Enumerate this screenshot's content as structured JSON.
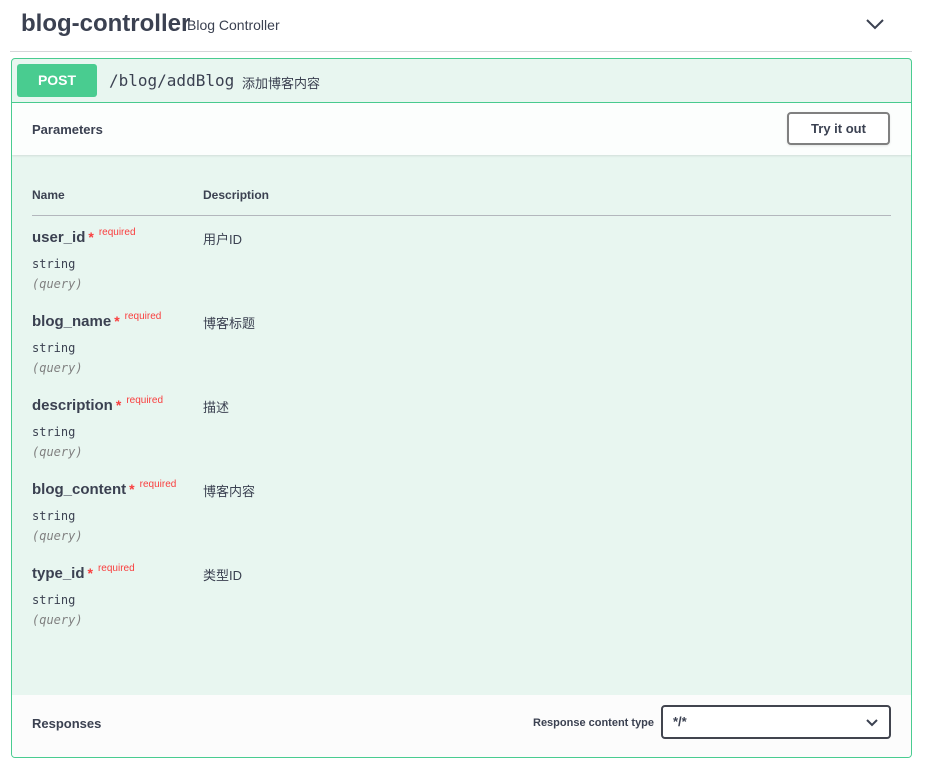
{
  "tag": {
    "name": "blog-controller",
    "description": "Blog Controller"
  },
  "operation": {
    "method": "POST",
    "path": "/blog/addBlog",
    "summary": "添加博客内容",
    "color": "#49cc90"
  },
  "parameters_section": {
    "title": "Parameters",
    "try_button": "Try it out",
    "col_name": "Name",
    "col_description": "Description",
    "params": [
      {
        "name": "user_id",
        "star": "*",
        "required": "required",
        "type": "string",
        "in": "(query)",
        "description": "用户ID"
      },
      {
        "name": "blog_name",
        "star": "*",
        "required": "required",
        "type": "string",
        "in": "(query)",
        "description": "博客标题"
      },
      {
        "name": "description",
        "star": "*",
        "required": "required",
        "type": "string",
        "in": "(query)",
        "description": "描述"
      },
      {
        "name": "blog_content",
        "star": "*",
        "required": "required",
        "type": "string",
        "in": "(query)",
        "description": "博客内容"
      },
      {
        "name": "type_id",
        "star": "*",
        "required": "required",
        "type": "string",
        "in": "(query)",
        "description": "类型ID"
      }
    ]
  },
  "responses": {
    "title": "Responses",
    "content_type_label": "Response content type",
    "content_type_value": "*/*"
  },
  "icons": {
    "collapse": "chevron-down-icon",
    "select": "chevron-down-icon"
  }
}
